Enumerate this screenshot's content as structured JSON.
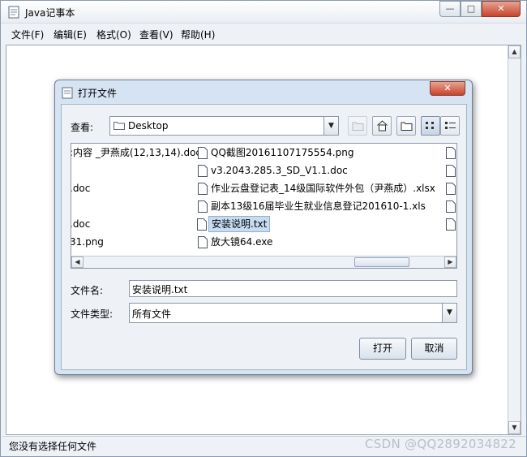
{
  "window": {
    "title": "Java记事本",
    "minimize_label": "—",
    "maximize_label": "□",
    "close_label": "✕"
  },
  "menu": [
    "文件(F)",
    "编辑(E)",
    "格式(O)",
    "查看(V)",
    "帮助(H)"
  ],
  "status": {
    "text": "您没有选择任何文件",
    "watermark": "CSDN @QQ2892034822"
  },
  "dialog": {
    "title": "打开文件",
    "close_label": "✕",
    "look_in_label": "查看:",
    "look_in_value": "Desktop",
    "file_name_label": "文件名:",
    "file_name_value": "安装说明.txt",
    "file_type_label": "文件类型:",
    "file_type_value": "所有文件",
    "open_label": "打开",
    "cancel_label": "取消",
    "files_col1": [
      ":内容 _尹燕成(12,13,14).doc",
      "",
      ".doc",
      "",
      ".doc",
      "31.png"
    ],
    "files_col2": [
      "QQ截图20161107175554.png",
      "v3.2043.285.3_SD_V1.1.doc",
      "作业云盘登记表_14级国际软件外包（尹燕成）.xlsx",
      "副本13级16届毕业生就业信息登记201610-1.xls",
      "安装说明.txt",
      "放大镜64.exe"
    ],
    "selected_file": "安装说明.txt"
  }
}
